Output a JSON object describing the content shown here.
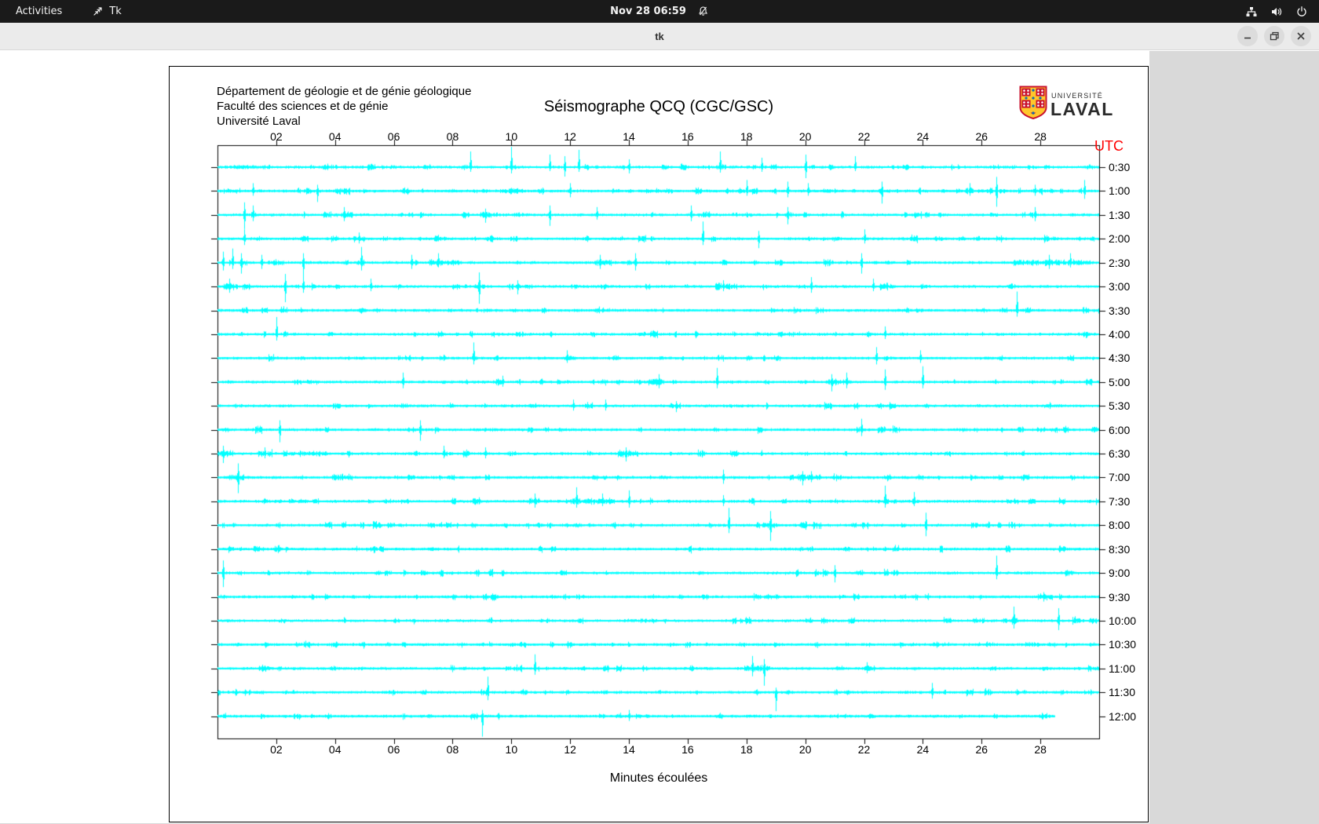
{
  "top_bar": {
    "activities_label": "Activities",
    "app_label": "Tk",
    "clock": "Nov 28 06:59"
  },
  "window": {
    "title": "tk"
  },
  "panel": {
    "header_lines": [
      "Département de géologie et de génie géologique",
      "Faculté des sciences et de génie",
      "Université Laval"
    ],
    "title": "Séismographe QCQ (CGC/GSC)",
    "logo": {
      "top_text": "UNIVERSITÉ",
      "bottom_text": "LAVAL"
    }
  },
  "colors": {
    "trace": "#00ffff",
    "utc_label": "#ff0000",
    "axis": "#000000",
    "window_bg": "#d9d9d9"
  },
  "chart_data": {
    "type": "line",
    "title": "Séismographe QCQ (CGC/GSC)",
    "xlabel": "Minutes écoulées",
    "right_axis_label": "UTC",
    "x_range": [
      0,
      30
    ],
    "x_ticks": [
      "02",
      "04",
      "06",
      "08",
      "10",
      "12",
      "14",
      "16",
      "18",
      "20",
      "22",
      "24",
      "26",
      "28"
    ],
    "grid": false,
    "noise_seed": 20231128,
    "rows": [
      {
        "label": "0:30",
        "end": 30,
        "spikes": [
          [
            8.6,
            20,
            6
          ],
          [
            10,
            26,
            8
          ],
          [
            11.3,
            16,
            5
          ],
          [
            11.8,
            14,
            12
          ],
          [
            12.3,
            22,
            6
          ],
          [
            14,
            10,
            8
          ],
          [
            17.1,
            20,
            7
          ],
          [
            18.5,
            12,
            6
          ],
          [
            20,
            16,
            14
          ],
          [
            21.7,
            14,
            5
          ]
        ],
        "bursts": [
          [
            0.3,
            1.8,
            2.5
          ],
          [
            9.8,
            10.2,
            3
          ],
          [
            16.9,
            17.3,
            3
          ]
        ]
      },
      {
        "label": "1:00",
        "end": 30,
        "spikes": [
          [
            1.2,
            10,
            6
          ],
          [
            3.4,
            8,
            14
          ],
          [
            12,
            10,
            8
          ],
          [
            18,
            14,
            6
          ],
          [
            19.4,
            12,
            8
          ],
          [
            20.1,
            10,
            6
          ],
          [
            22.6,
            12,
            16
          ],
          [
            25.6,
            10,
            6
          ],
          [
            26.5,
            18,
            20
          ],
          [
            27.8,
            8,
            6
          ],
          [
            29.5,
            14,
            10
          ]
        ],
        "bursts": [
          [
            0.2,
            0.8,
            3
          ],
          [
            4.0,
            4.5,
            4
          ],
          [
            9.9,
            10.3,
            4
          ]
        ]
      },
      {
        "label": "1:30",
        "end": 30,
        "spikes": [
          [
            0.9,
            16,
            18
          ],
          [
            1.2,
            12,
            8
          ],
          [
            4.3,
            10,
            8
          ],
          [
            9.1,
            8,
            10
          ],
          [
            11.3,
            12,
            14
          ],
          [
            12.9,
            10,
            6
          ],
          [
            16.1,
            12,
            8
          ],
          [
            19.4,
            10,
            12
          ],
          [
            27.8,
            10,
            8
          ]
        ],
        "bursts": [
          [
            4.2,
            4.6,
            4
          ],
          [
            8.9,
            9.3,
            4
          ],
          [
            19.2,
            19.6,
            3
          ]
        ]
      },
      {
        "label": "2:00",
        "end": 30,
        "spikes": [
          [
            0.9,
            12,
            8
          ],
          [
            4.8,
            8,
            6
          ],
          [
            16.5,
            22,
            8
          ],
          [
            18.4,
            10,
            12
          ],
          [
            22,
            12,
            6
          ]
        ],
        "bursts": [
          [
            4.6,
            5.0,
            4
          ]
        ]
      },
      {
        "label": "2:30",
        "end": 30,
        "spikes": [
          [
            0.2,
            14,
            10
          ],
          [
            0.5,
            18,
            8
          ],
          [
            0.8,
            12,
            14
          ],
          [
            1.5,
            10,
            8
          ],
          [
            2.9,
            12,
            18
          ],
          [
            4.9,
            20,
            10
          ],
          [
            6.6,
            10,
            8
          ],
          [
            7.5,
            12,
            6
          ],
          [
            13,
            10,
            8
          ],
          [
            14.2,
            12,
            10
          ],
          [
            21.9,
            12,
            14
          ],
          [
            28.3,
            10,
            8
          ],
          [
            29,
            12,
            6
          ]
        ],
        "bursts": [
          [
            7.2,
            8.2,
            4
          ],
          [
            12.8,
            13.4,
            4
          ],
          [
            27.3,
            29.7,
            3.5
          ]
        ]
      },
      {
        "label": "3:00",
        "end": 30,
        "spikes": [
          [
            0.4,
            10,
            8
          ],
          [
            2.3,
            16,
            20
          ],
          [
            2.9,
            14,
            8
          ],
          [
            5.2,
            10,
            6
          ],
          [
            8.9,
            18,
            22
          ],
          [
            10.2,
            8,
            10
          ],
          [
            17.2,
            8,
            6
          ],
          [
            20.2,
            12,
            8
          ],
          [
            22.3,
            10,
            6
          ]
        ],
        "bursts": [
          [
            0.2,
            0.7,
            4
          ],
          [
            8.7,
            9.1,
            3
          ]
        ]
      },
      {
        "label": "3:30",
        "end": 30,
        "spikes": [
          [
            27.2,
            24,
            8
          ]
        ],
        "bursts": []
      },
      {
        "label": "4:00",
        "end": 30,
        "spikes": [
          [
            2.0,
            22,
            8
          ],
          [
            22.7,
            10,
            6
          ]
        ],
        "bursts": []
      },
      {
        "label": "4:30",
        "end": 30,
        "spikes": [
          [
            8.7,
            20,
            8
          ],
          [
            11.9,
            10,
            6
          ],
          [
            22.4,
            14,
            8
          ],
          [
            23.9,
            10,
            6
          ]
        ],
        "bursts": [
          [
            11.8,
            12.2,
            3
          ]
        ]
      },
      {
        "label": "5:00",
        "end": 30,
        "spikes": [
          [
            6.3,
            12,
            8
          ],
          [
            9.7,
            8,
            6
          ],
          [
            15,
            10,
            8
          ],
          [
            17,
            18,
            8
          ],
          [
            20.9,
            10,
            12
          ],
          [
            21.4,
            12,
            8
          ],
          [
            22.7,
            16,
            10
          ],
          [
            24,
            20,
            8
          ]
        ],
        "bursts": [
          [
            14.6,
            15.2,
            4
          ],
          [
            20.7,
            21.6,
            3.5
          ]
        ]
      },
      {
        "label": "5:30",
        "end": 30,
        "spikes": [
          [
            12.1,
            8,
            6
          ],
          [
            13.2,
            8,
            6
          ],
          [
            15.6,
            6,
            8
          ]
        ],
        "bursts": []
      },
      {
        "label": "6:00",
        "end": 30,
        "spikes": [
          [
            2.1,
            12,
            16
          ],
          [
            6.9,
            12,
            14
          ],
          [
            21.9,
            14,
            8
          ]
        ],
        "bursts": []
      },
      {
        "label": "6:30",
        "end": 30,
        "spikes": [
          [
            0.2,
            10,
            12
          ],
          [
            1.6,
            8,
            6
          ],
          [
            7.7,
            10,
            6
          ],
          [
            9.1,
            8,
            6
          ],
          [
            13.9,
            8,
            10
          ]
        ],
        "bursts": [
          [
            0.1,
            0.6,
            4
          ],
          [
            3.2,
            3.7,
            3
          ],
          [
            9.8,
            10.2,
            3
          ],
          [
            13.7,
            14.3,
            4
          ]
        ]
      },
      {
        "label": "7:00",
        "end": 30,
        "spikes": [
          [
            0.7,
            18,
            20
          ],
          [
            17.2,
            10,
            8
          ],
          [
            19.9,
            8,
            10
          ],
          [
            20.2,
            8,
            6
          ]
        ],
        "bursts": [
          [
            0.3,
            0.9,
            4
          ],
          [
            3.9,
            4.6,
            4
          ],
          [
            19.8,
            20.5,
            3.5
          ]
        ]
      },
      {
        "label": "7:30",
        "end": 30,
        "spikes": [
          [
            10.8,
            10,
            8
          ],
          [
            12.2,
            18,
            8
          ],
          [
            13.1,
            10,
            6
          ],
          [
            14,
            14,
            8
          ],
          [
            17.2,
            8,
            6
          ],
          [
            22.7,
            20,
            8
          ],
          [
            23.7,
            12,
            6
          ]
        ],
        "bursts": [
          [
            10.6,
            11.0,
            4
          ],
          [
            12.0,
            13.5,
            3.5
          ]
        ]
      },
      {
        "label": "8:00",
        "end": 30,
        "spikes": [
          [
            17.4,
            22,
            10
          ],
          [
            18.8,
            18,
            20
          ],
          [
            24.1,
            16,
            14
          ]
        ],
        "bursts": [
          [
            18.5,
            19.1,
            3.5
          ]
        ]
      },
      {
        "label": "8:30",
        "end": 30,
        "spikes": [],
        "bursts": []
      },
      {
        "label": "9:00",
        "end": 30,
        "spikes": [
          [
            0.2,
            16,
            18
          ],
          [
            21,
            10,
            12
          ],
          [
            26.5,
            22,
            8
          ]
        ],
        "bursts": []
      },
      {
        "label": "9:30",
        "end": 30,
        "spikes": [
          [
            28.1,
            6,
            6
          ]
        ],
        "bursts": [
          [
            27.9,
            28.4,
            4
          ]
        ]
      },
      {
        "label": "10:00",
        "end": 30,
        "spikes": [
          [
            27.1,
            18,
            10
          ],
          [
            28.6,
            16,
            12
          ]
        ],
        "bursts": []
      },
      {
        "label": "10:30",
        "end": 30,
        "spikes": [],
        "bursts": []
      },
      {
        "label": "11:00",
        "end": 30,
        "spikes": [
          [
            10.8,
            18,
            8
          ],
          [
            18.2,
            16,
            10
          ],
          [
            18.6,
            12,
            22
          ],
          [
            22.1,
            8,
            6
          ]
        ],
        "bursts": [
          [
            18.0,
            18.8,
            4
          ],
          [
            22.0,
            22.4,
            3.5
          ]
        ]
      },
      {
        "label": "11:30",
        "end": 30,
        "spikes": [
          [
            9.2,
            20,
            10
          ],
          [
            19,
            6,
            24
          ],
          [
            24.3,
            12,
            8
          ]
        ],
        "bursts": []
      },
      {
        "label": "12:00",
        "end": 28.5,
        "spikes": [
          [
            9,
            8,
            26
          ],
          [
            14,
            8,
            6
          ]
        ],
        "bursts": []
      }
    ]
  }
}
